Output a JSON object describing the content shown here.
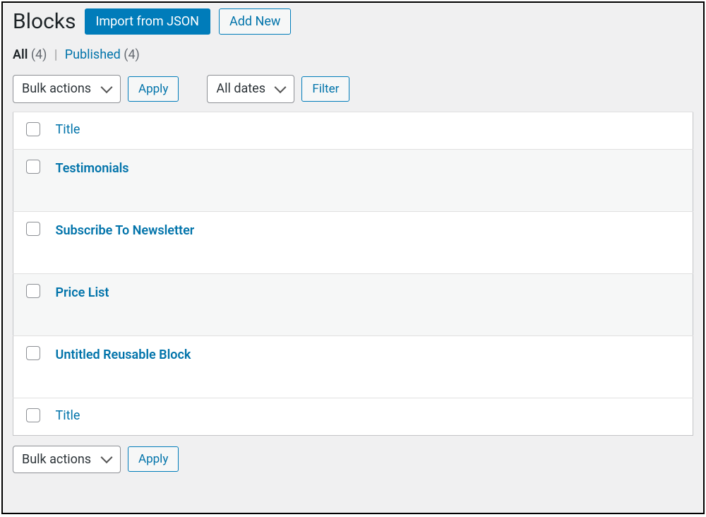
{
  "header": {
    "title": "Blocks",
    "import_button": "Import from JSON",
    "add_new_button": "Add New"
  },
  "status_filters": {
    "all_label": "All",
    "all_count": "(4)",
    "published_label": "Published",
    "published_count": "(4)"
  },
  "bulk": {
    "select_label": "Bulk actions",
    "apply_label": "Apply"
  },
  "date_filter": {
    "select_label": "All dates",
    "filter_label": "Filter"
  },
  "table": {
    "column_title": "Title",
    "rows": [
      {
        "title": "Testimonials"
      },
      {
        "title": "Subscribe To Newsletter"
      },
      {
        "title": "Price List"
      },
      {
        "title": "Untitled Reusable Block"
      }
    ]
  }
}
